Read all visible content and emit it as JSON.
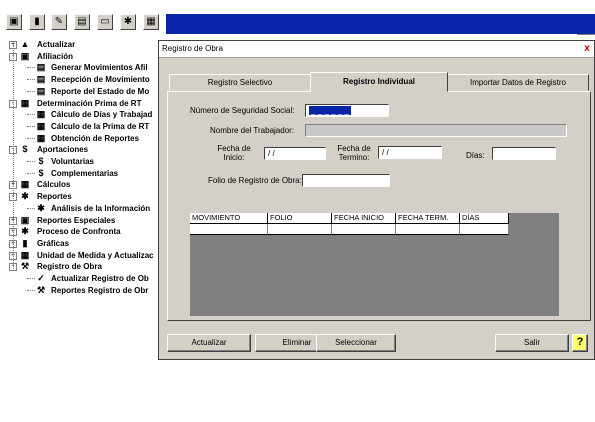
{
  "toolbar": {
    "buttons": [
      {
        "icon": "workstation-icon",
        "glyph": "▣"
      },
      {
        "icon": "chart-icon",
        "glyph": "▮"
      },
      {
        "icon": "notepad-icon",
        "glyph": "✎"
      },
      {
        "icon": "save-icon",
        "glyph": "▤"
      },
      {
        "icon": "print-icon",
        "glyph": "▭"
      },
      {
        "icon": "tools-icon",
        "glyph": "✱"
      },
      {
        "icon": "network-icon",
        "glyph": "▦"
      }
    ]
  },
  "tree": [
    {
      "label": "Actualizar",
      "level": 0,
      "expander": "+",
      "icon": "▲"
    },
    {
      "label": "Afiliación",
      "level": 0,
      "expander": "-",
      "icon": "▣"
    },
    {
      "label": "Generar Movimientos Afil",
      "level": 1,
      "icon": "▤"
    },
    {
      "label": "Recepción de Movimiento",
      "level": 1,
      "icon": "▤"
    },
    {
      "label": "Reporte del Estado de Mo",
      "level": 1,
      "icon": "▤"
    },
    {
      "label": "Determinación Prima de RT",
      "level": 0,
      "expander": "-",
      "icon": "▦"
    },
    {
      "label": "Cálculo de Días y Trabajad",
      "level": 1,
      "icon": "▦"
    },
    {
      "label": "Cálculo de la Prima de RT",
      "level": 1,
      "icon": "▦"
    },
    {
      "label": "Obtención de Reportes",
      "level": 1,
      "icon": "▦"
    },
    {
      "label": "Aportaciones",
      "level": 0,
      "expander": "-",
      "icon": "$"
    },
    {
      "label": "Voluntarias",
      "level": 1,
      "icon": "$"
    },
    {
      "label": "Complementarias",
      "level": 1,
      "icon": "$"
    },
    {
      "label": "Cálculos",
      "level": 0,
      "expander": "+",
      "icon": "▦"
    },
    {
      "label": "Reportes",
      "level": 0,
      "expander": "-",
      "icon": "✱"
    },
    {
      "label": "Análisis de la Información",
      "level": 1,
      "icon": "✱"
    },
    {
      "label": "Reportes Especiales",
      "level": 0,
      "expander": "+",
      "icon": "▣"
    },
    {
      "label": "Proceso de Confronta",
      "level": 0,
      "expander": "+",
      "icon": "✱"
    },
    {
      "label": "Gráficas",
      "level": 0,
      "expander": "+",
      "icon": "▮"
    },
    {
      "label": "Unidad de Medida y Actualizac",
      "level": 0,
      "expander": "+",
      "icon": "▦"
    },
    {
      "label": "Registro de Obra",
      "level": 0,
      "expander": "-",
      "icon": "⚒"
    },
    {
      "label": "Actualizar Registro de Ob",
      "level": 1,
      "icon": "✓"
    },
    {
      "label": "Reportes Registro de Obr",
      "level": 1,
      "icon": "⚒"
    }
  ],
  "dialog": {
    "title": "Registro de Obra",
    "close": "x",
    "tabs": [
      "Registro Selectivo",
      "Registro Individual",
      "Importar Datos de Registro"
    ],
    "active_tab": 1,
    "labels": {
      "nss": "Número de Seguridad Social:",
      "nombre": "Nombre del Trabajador:",
      "fecha_inicio": "Fecha de Inicio:",
      "fecha_termino": "Fecha de Termino:",
      "dias": "Días:",
      "folio": "Folio de Registro de Obra:"
    },
    "values": {
      "nss": "_ _ _ _ _ _",
      "fecha_inicio": "/ /",
      "fecha_termino": "/ /",
      "dias": "",
      "folio": ""
    },
    "grid_columns": [
      "MOVIMIENTO",
      "FOLIO",
      "FECHA INICIO",
      "FECHA TERM.",
      "DÍAS"
    ],
    "buttons": {
      "actualizar": "Actualizar",
      "eliminar": "Eliminar",
      "seleccionar": "Seleccionar",
      "salir": "Salir",
      "help": "?"
    }
  },
  "colors": {
    "accent": "#0a24a8",
    "face": "#d4d0c8",
    "help": "#ffff66"
  }
}
